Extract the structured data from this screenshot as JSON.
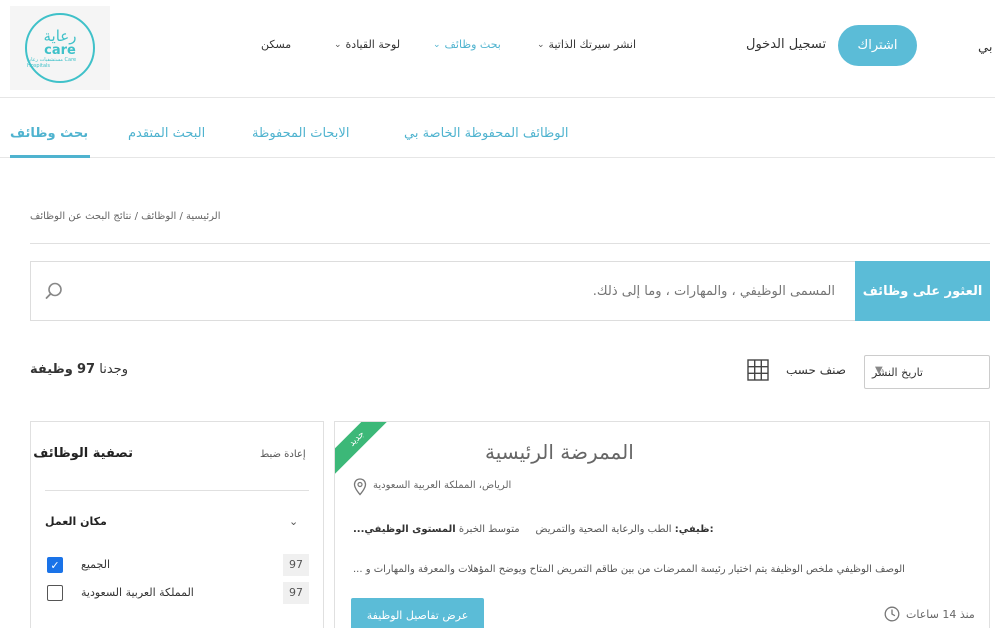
{
  "header": {
    "logo": {
      "ar": "رعاية",
      "en": "care",
      "small": "مستشفيات رعاية Care Hospitals"
    },
    "nav": [
      {
        "label": "مسكن"
      },
      {
        "label": "لوحة القيادة"
      },
      {
        "label": "بحث وظائف"
      },
      {
        "label": "انشر سيرتك الذاتية"
      }
    ],
    "login": "تسجيل الدخول",
    "subscribe": "اشتراك",
    "lang": "بي"
  },
  "tabs": [
    {
      "label": "الوظائف المحفوظة الخاصة بي"
    },
    {
      "label": "الابحاث المحفوظة"
    },
    {
      "label": "البحث المتقدم"
    },
    {
      "label": "بحث وظائف"
    }
  ],
  "breadcrumb": "الرئيسية / الوظائف / نتائج البحث عن الوظائف",
  "search": {
    "placeholder": "المسمى الوظيفي ، والمهارات ، وما إلى ذلك.",
    "button": "العثور على وظائف"
  },
  "results": {
    "found_prefix": "وجدنا",
    "count": "97",
    "found_suffix": "وظيفة",
    "sort_label": "صنف حسب",
    "sort_value": "تاريخ النشر"
  },
  "filter": {
    "title": "تصفية الوظائف",
    "reset": "إعادة ضبط",
    "section": "مكان العمل",
    "rows": [
      {
        "label": "الجميع",
        "count": "97"
      },
      {
        "label": "المملكة العربية السعودية",
        "count": "97"
      }
    ]
  },
  "job": {
    "ribbon": "جديد",
    "title": "الممرضة الرئيسية",
    "location": "الرياض، المملكة العربية السعودية",
    "meta_level_label": "المستوى الوظيفي:",
    "meta_level_value": "متوسط الخبرة",
    "meta_field_label": "...ظيفي:",
    "meta_field_value": "الطب والرعاية الصحية والتمريض",
    "description": "... الوصف الوظيفي ملخص الوظيفة يتم اختيار رئيسة الممرضات من بين طاقم التمريض المتاح ويوضح المؤهلات والمعرفة والمهارات و",
    "details_button": "عرض تفاصيل الوظيفة",
    "posted": "منذ 14 ساعات"
  }
}
